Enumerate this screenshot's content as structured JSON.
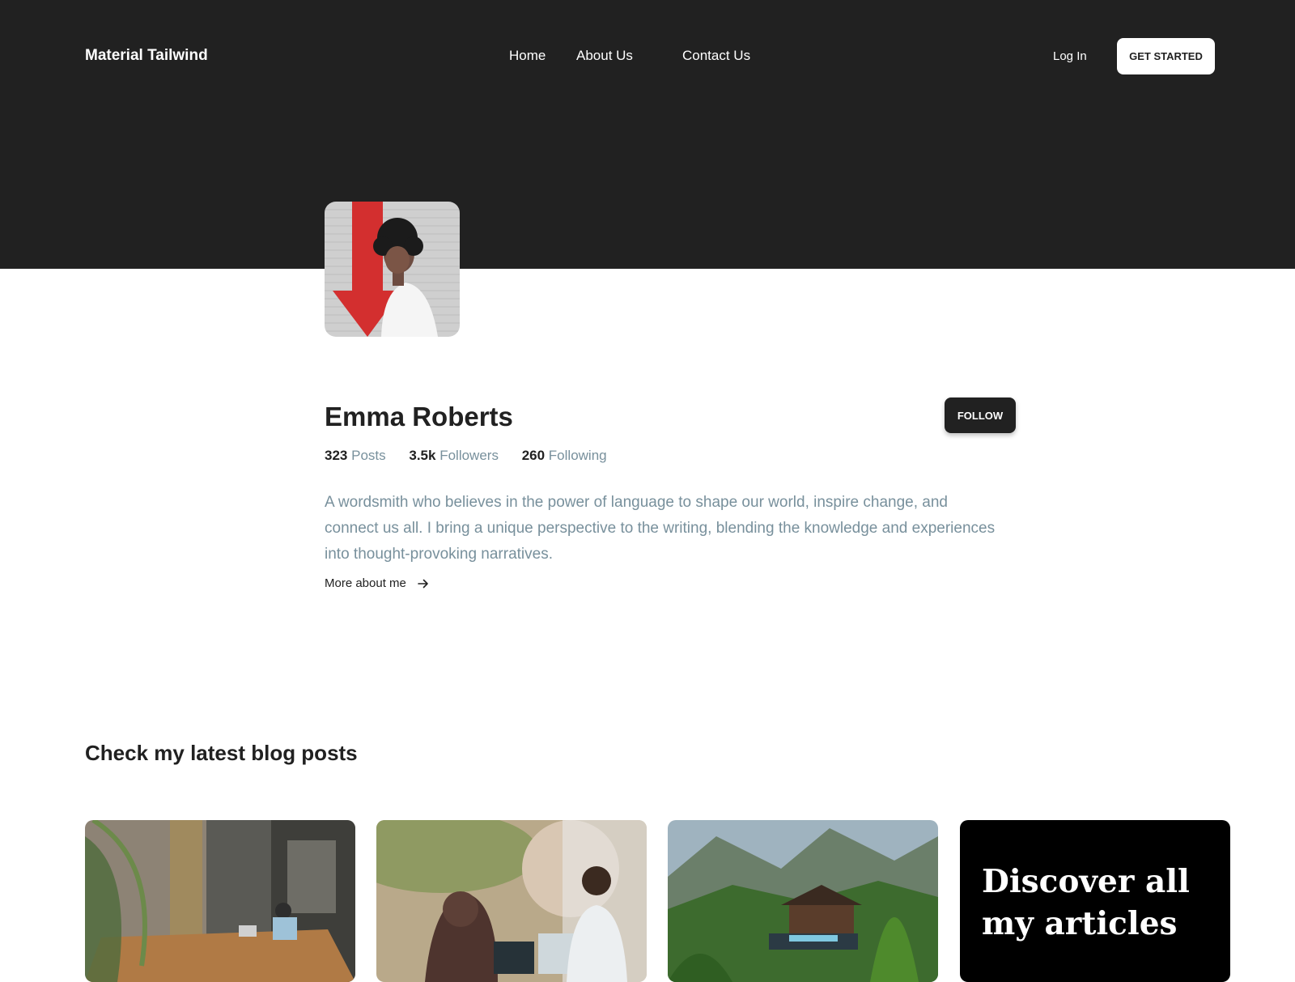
{
  "header": {
    "brand": "Material Tailwind",
    "nav": [
      {
        "label": "Home"
      },
      {
        "label": "About Us"
      },
      {
        "label": "Contact Us"
      }
    ],
    "login_label": "Log In",
    "cta_label": "GET STARTED"
  },
  "profile": {
    "name": "Emma Roberts",
    "follow_label": "FOLLOW",
    "stats": [
      {
        "value": "323",
        "label": "Posts"
      },
      {
        "value": "3.5k",
        "label": "Followers"
      },
      {
        "value": "260",
        "label": "Following"
      }
    ],
    "bio": "A wordsmith who believes in the power of language to shape our world, inspire change, and connect us all. I bring a unique perspective to the writing, blending the knowledge and experiences into thought-provoking narratives.",
    "more_label": "More about me",
    "more_icon": "arrow-right-icon"
  },
  "blog": {
    "title": "Check my latest blog posts",
    "discover_text": "Discover all my articles"
  },
  "colors": {
    "dark": "#212121",
    "muted": "#78909c",
    "white": "#ffffff"
  }
}
